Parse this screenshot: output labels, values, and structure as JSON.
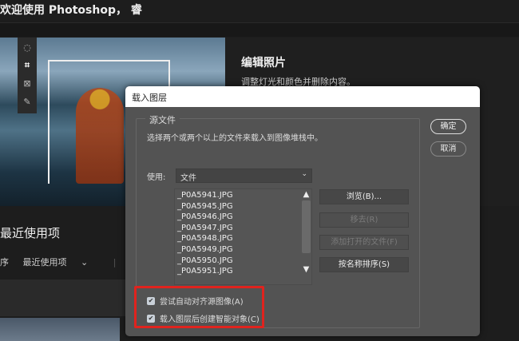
{
  "background": {
    "welcome": "欢迎使用 Photoshop， 睿",
    "edit_title": "编辑照片",
    "edit_desc": "调整灯光和颜色并删除内容。",
    "recent_title": "最近使用项",
    "sort_label": "序",
    "sort_value": "最近使用项",
    "sort_dir_icon": "↓"
  },
  "dialog": {
    "title": "载入图层",
    "group_label": "源文件",
    "group_desc": "选择两个或两个以上的文件来载入到图像堆栈中。",
    "ok": "确定",
    "cancel": "取消",
    "use_label": "使用:",
    "use_value": "文件",
    "files": [
      "_P0A5941.JPG",
      "_P0A5945.JPG",
      "_P0A5946.JPG",
      "_P0A5947.JPG",
      "_P0A5948.JPG",
      "_P0A5949.JPG",
      "_P0A5950.JPG",
      "_P0A5951.JPG"
    ],
    "browse": "浏览(B)...",
    "remove": "移去(R)",
    "add_open": "添加打开的文件(F)",
    "sort_by_name": "按名称排序(S)",
    "check_align": "尝试自动对齐源图像(A)",
    "check_smart": "载入图层后创建智能对象(C)",
    "check_align_checked": true,
    "check_smart_checked": true,
    "highlight_color": "#e0231e"
  }
}
